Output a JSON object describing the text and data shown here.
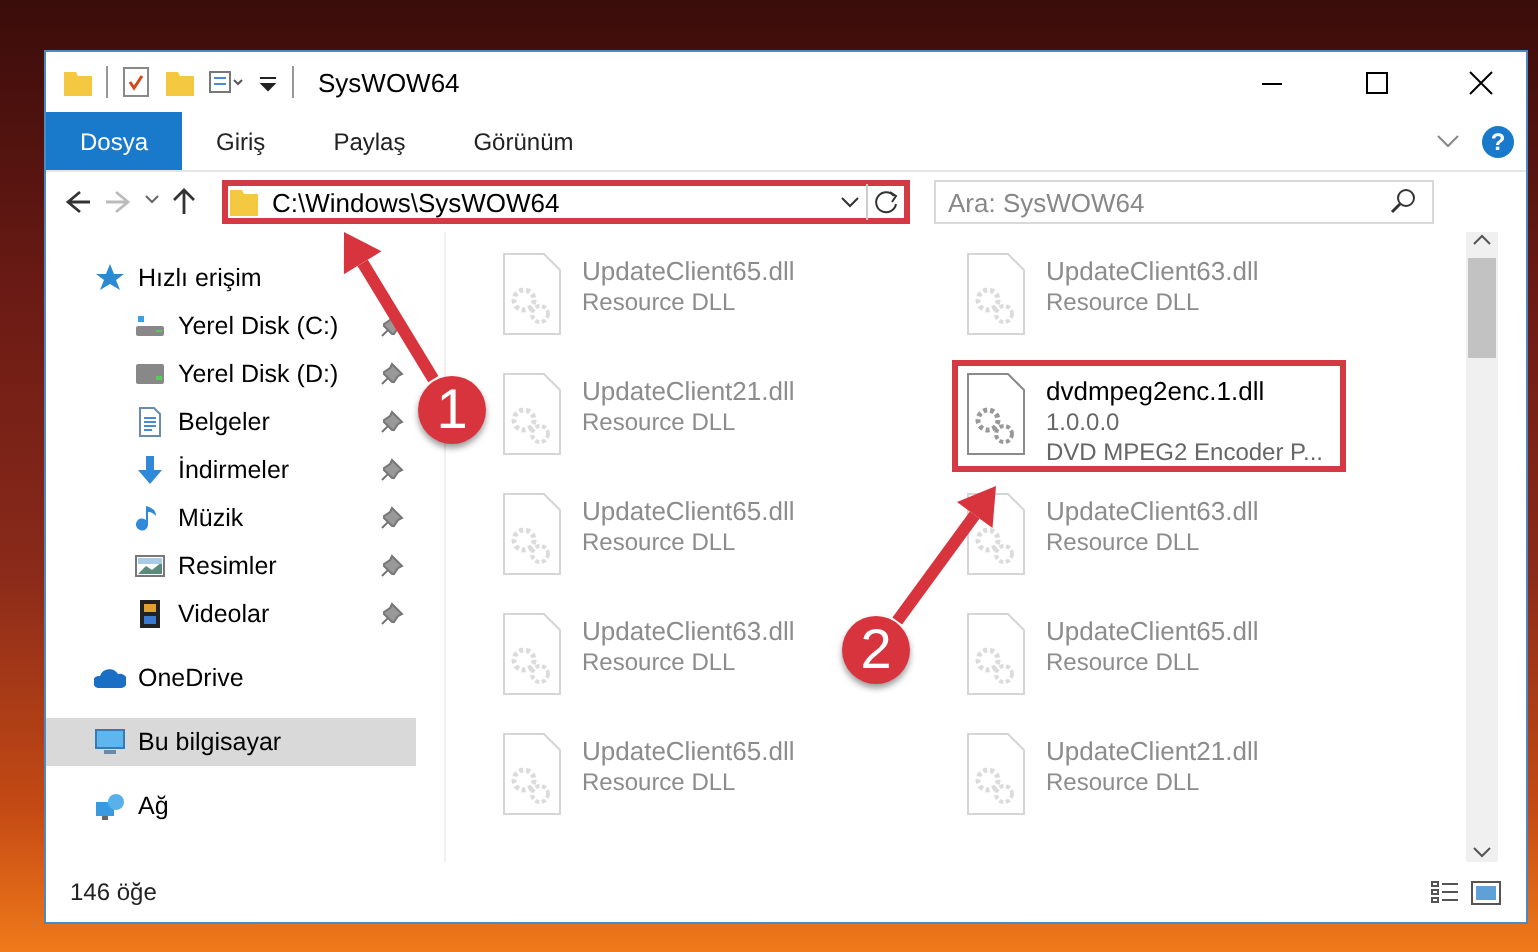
{
  "window": {
    "title": "SysWOW64"
  },
  "ribbon_tabs": [
    {
      "label": "Dosya",
      "selected": true
    },
    {
      "label": "Giriş",
      "selected": false
    },
    {
      "label": "Paylaş",
      "selected": false
    },
    {
      "label": "Görünüm",
      "selected": false
    }
  ],
  "help": "?",
  "address": {
    "path": "C:\\Windows\\SysWOW64",
    "highlighted": true
  },
  "search": {
    "placeholder": "Ara: SysWOW64"
  },
  "nav_items": [
    {
      "label": "Hızlı erişim",
      "selected": false,
      "children": [
        {
          "label": "Yerel Disk (C:)",
          "pinned": true,
          "selected": false
        },
        {
          "label": "Yerel Disk (D:)",
          "pinned": true,
          "selected": false
        },
        {
          "label": "Belgeler",
          "pinned": true,
          "selected": false
        },
        {
          "label": "İndirmeler",
          "pinned": true,
          "selected": false
        },
        {
          "label": "Müzik",
          "pinned": true,
          "selected": false
        },
        {
          "label": "Resimler",
          "pinned": true,
          "selected": false
        },
        {
          "label": "Videolar",
          "pinned": true,
          "selected": false
        }
      ]
    },
    {
      "label": "OneDrive",
      "selected": false
    },
    {
      "label": "Bu bilgisayar",
      "selected": true
    },
    {
      "label": "Ağ",
      "selected": false
    }
  ],
  "files": [
    {
      "name": "UpdateClient65.dll",
      "lines": [
        "Resource DLL"
      ],
      "highlighted": false
    },
    {
      "name": "UpdateClient63.dll",
      "lines": [
        "Resource DLL"
      ],
      "highlighted": false
    },
    {
      "name": "UpdateClient21.dll",
      "lines": [
        "Resource DLL"
      ],
      "highlighted": false
    },
    {
      "name": "dvdmpeg2enc.1.dll",
      "lines": [
        "1.0.0.0",
        "DVD MPEG2 Encoder P..."
      ],
      "highlighted": true
    },
    {
      "name": "UpdateClient65.dll",
      "lines": [
        "Resource DLL"
      ],
      "highlighted": false
    },
    {
      "name": "UpdateClient63.dll",
      "lines": [
        "Resource DLL"
      ],
      "highlighted": false
    },
    {
      "name": "UpdateClient63.dll",
      "lines": [
        "Resource DLL"
      ],
      "highlighted": false
    },
    {
      "name": "UpdateClient65.dll",
      "lines": [
        "Resource DLL"
      ],
      "highlighted": false
    },
    {
      "name": "UpdateClient65.dll",
      "lines": [
        "Resource DLL"
      ],
      "highlighted": false
    },
    {
      "name": "UpdateClient21.dll",
      "lines": [
        "Resource DLL"
      ],
      "highlighted": false
    }
  ],
  "annotations": [
    {
      "number": "1"
    },
    {
      "number": "2"
    }
  ],
  "status_bar": {
    "item_count": "146 öğe"
  }
}
